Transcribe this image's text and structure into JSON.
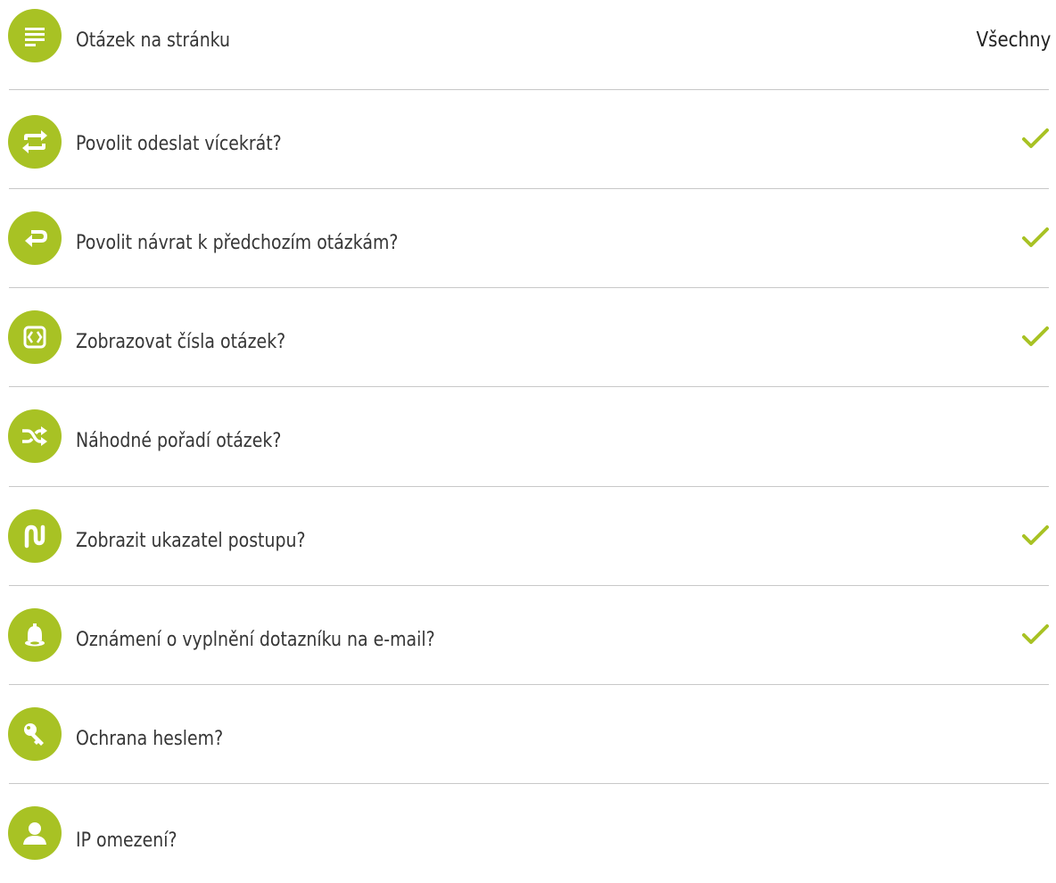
{
  "accent_color": "#a8c224",
  "settings": [
    {
      "label": "Otázek na stránku",
      "value": "Všechny",
      "icon": "list-icon",
      "checked": null
    },
    {
      "label": "Povolit odeslat vícekrát?",
      "icon": "repeat-icon",
      "checked": true
    },
    {
      "label": "Povolit návrat k předchozím otázkám?",
      "icon": "return-arrow-icon",
      "checked": true
    },
    {
      "label": "Zobrazovat čísla otázek?",
      "icon": "code-brackets-icon",
      "checked": true
    },
    {
      "label": "Náhodné pořadí otázek?",
      "icon": "shuffle-icon",
      "checked": false
    },
    {
      "label": "Zobrazit ukazatel postupu?",
      "icon": "progress-path-icon",
      "checked": true
    },
    {
      "label": "Oznámení o vyplnění dotazníku na e-mail?",
      "icon": "bell-icon",
      "checked": true
    },
    {
      "label": "Ochrana heslem?",
      "icon": "key-icon",
      "checked": false
    },
    {
      "label": "IP omezení?",
      "icon": "user-icon",
      "checked": false
    }
  ]
}
